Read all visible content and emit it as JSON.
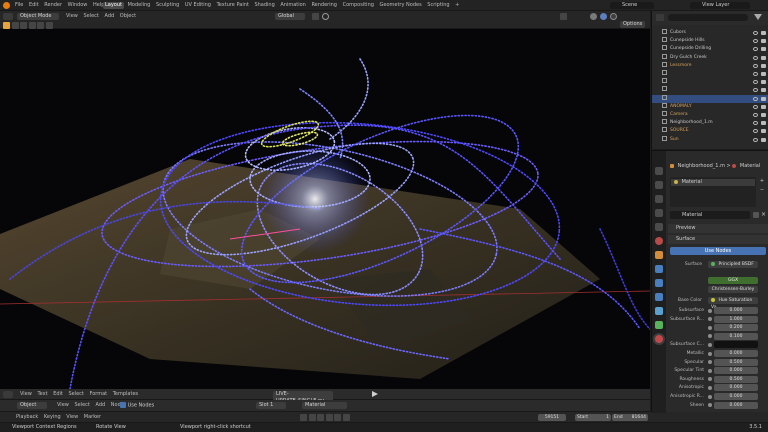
{
  "topbar": {
    "menus": [
      "File",
      "Edit",
      "Render",
      "Window",
      "Help"
    ],
    "workspaces": [
      "Layout",
      "Modeling",
      "Sculpting",
      "UV Editing",
      "Texture Paint",
      "Shading",
      "Animation",
      "Rendering",
      "Compositing",
      "Geometry Nodes",
      "Scripting"
    ],
    "active_workspace": "Layout",
    "add_tab": "+",
    "scene_label": "Scene",
    "view_layer_label": "View Layer"
  },
  "viewport_header": {
    "mode": "Object Mode",
    "menus": [
      "View",
      "Select",
      "Add",
      "Object"
    ],
    "transform": "Global",
    "options": "Options"
  },
  "outliner": {
    "items": [
      {
        "name": "Cubors",
        "color": "#c9c9c9"
      },
      {
        "name": "Cunepside Hills",
        "color": "#c9c9c9"
      },
      {
        "name": "Cunepside Drilling",
        "color": "#c9c9c9"
      },
      {
        "name": "Dry Gulch Creek",
        "color": "#c9c9c9"
      },
      {
        "name": "Lessmore",
        "color": "#d7a35a"
      },
      {
        "name": "",
        "color": "#c9c9c9"
      },
      {
        "name": "",
        "color": "#c9c9c9"
      },
      {
        "name": "",
        "color": "#c9c9c9"
      },
      {
        "name": "",
        "color": "#c9c9c9"
      },
      {
        "name": "ANOMALY",
        "color": "#d7a35a"
      },
      {
        "name": "Camera",
        "color": "#d7a35a"
      },
      {
        "name": "Neighborhood_1.m",
        "color": "#c9c9c9"
      },
      {
        "name": "SOURCE",
        "color": "#d7a35a"
      },
      {
        "name": "Sun",
        "color": "#d7a35a"
      }
    ],
    "selected_index": 8
  },
  "properties": {
    "breadcrumb_object": "Neighborhood_1.m",
    "breadcrumb_material": "Material",
    "material_slot": "Material",
    "material_name": "Material",
    "preview": "Preview",
    "surface_panel": "Surface",
    "use_nodes": "Use Nodes",
    "surface_label": "Surface",
    "surface_value": "Principled BSDF",
    "ggx": "GGX",
    "sss_method": "Christensen-Burley",
    "base_color_label": "Base Color",
    "base_color_value": "Hue Saturation Va...",
    "fields": [
      {
        "label": "Subsurface",
        "value": "0.000"
      },
      {
        "label": "Subsurface R...",
        "value": "1.000"
      },
      {
        "label": "",
        "value": "0.200"
      },
      {
        "label": "",
        "value": "0.100"
      },
      {
        "label": "Subsurface C...",
        "value": ""
      },
      {
        "label": "Metallic",
        "value": "0.000"
      },
      {
        "label": "Specular",
        "value": "0.500"
      },
      {
        "label": "Specular Tint",
        "value": "0.000"
      },
      {
        "label": "Roughness",
        "value": "0.500"
      },
      {
        "label": "Anisotropic",
        "value": "0.000"
      },
      {
        "label": "Anisotropic R...",
        "value": "0.000"
      },
      {
        "label": "Sheen",
        "value": "0.000"
      }
    ]
  },
  "text_editor": {
    "menus": [
      "View",
      "Text",
      "Edit",
      "Select",
      "Format",
      "Templates"
    ],
    "filename": "LIVE-UPDATE_SINGLE.py"
  },
  "node_editor": {
    "object": "Object",
    "menus": [
      "View",
      "Select",
      "Add",
      "Node"
    ],
    "use_nodes": "Use Nodes",
    "slot": "Slot 1",
    "material": "Material"
  },
  "timeline": {
    "menus": [
      "Playback",
      "Keying",
      "View",
      "Marker"
    ],
    "current_frame": "59151",
    "start_label": "Start",
    "start_value": "1",
    "end_label": "End",
    "end_value": "81644"
  },
  "statusbar": {
    "items": [
      "Viewport Context Regions",
      "Rotate View",
      "Viewport right-click shortcut"
    ],
    "version": "3.5.1"
  }
}
